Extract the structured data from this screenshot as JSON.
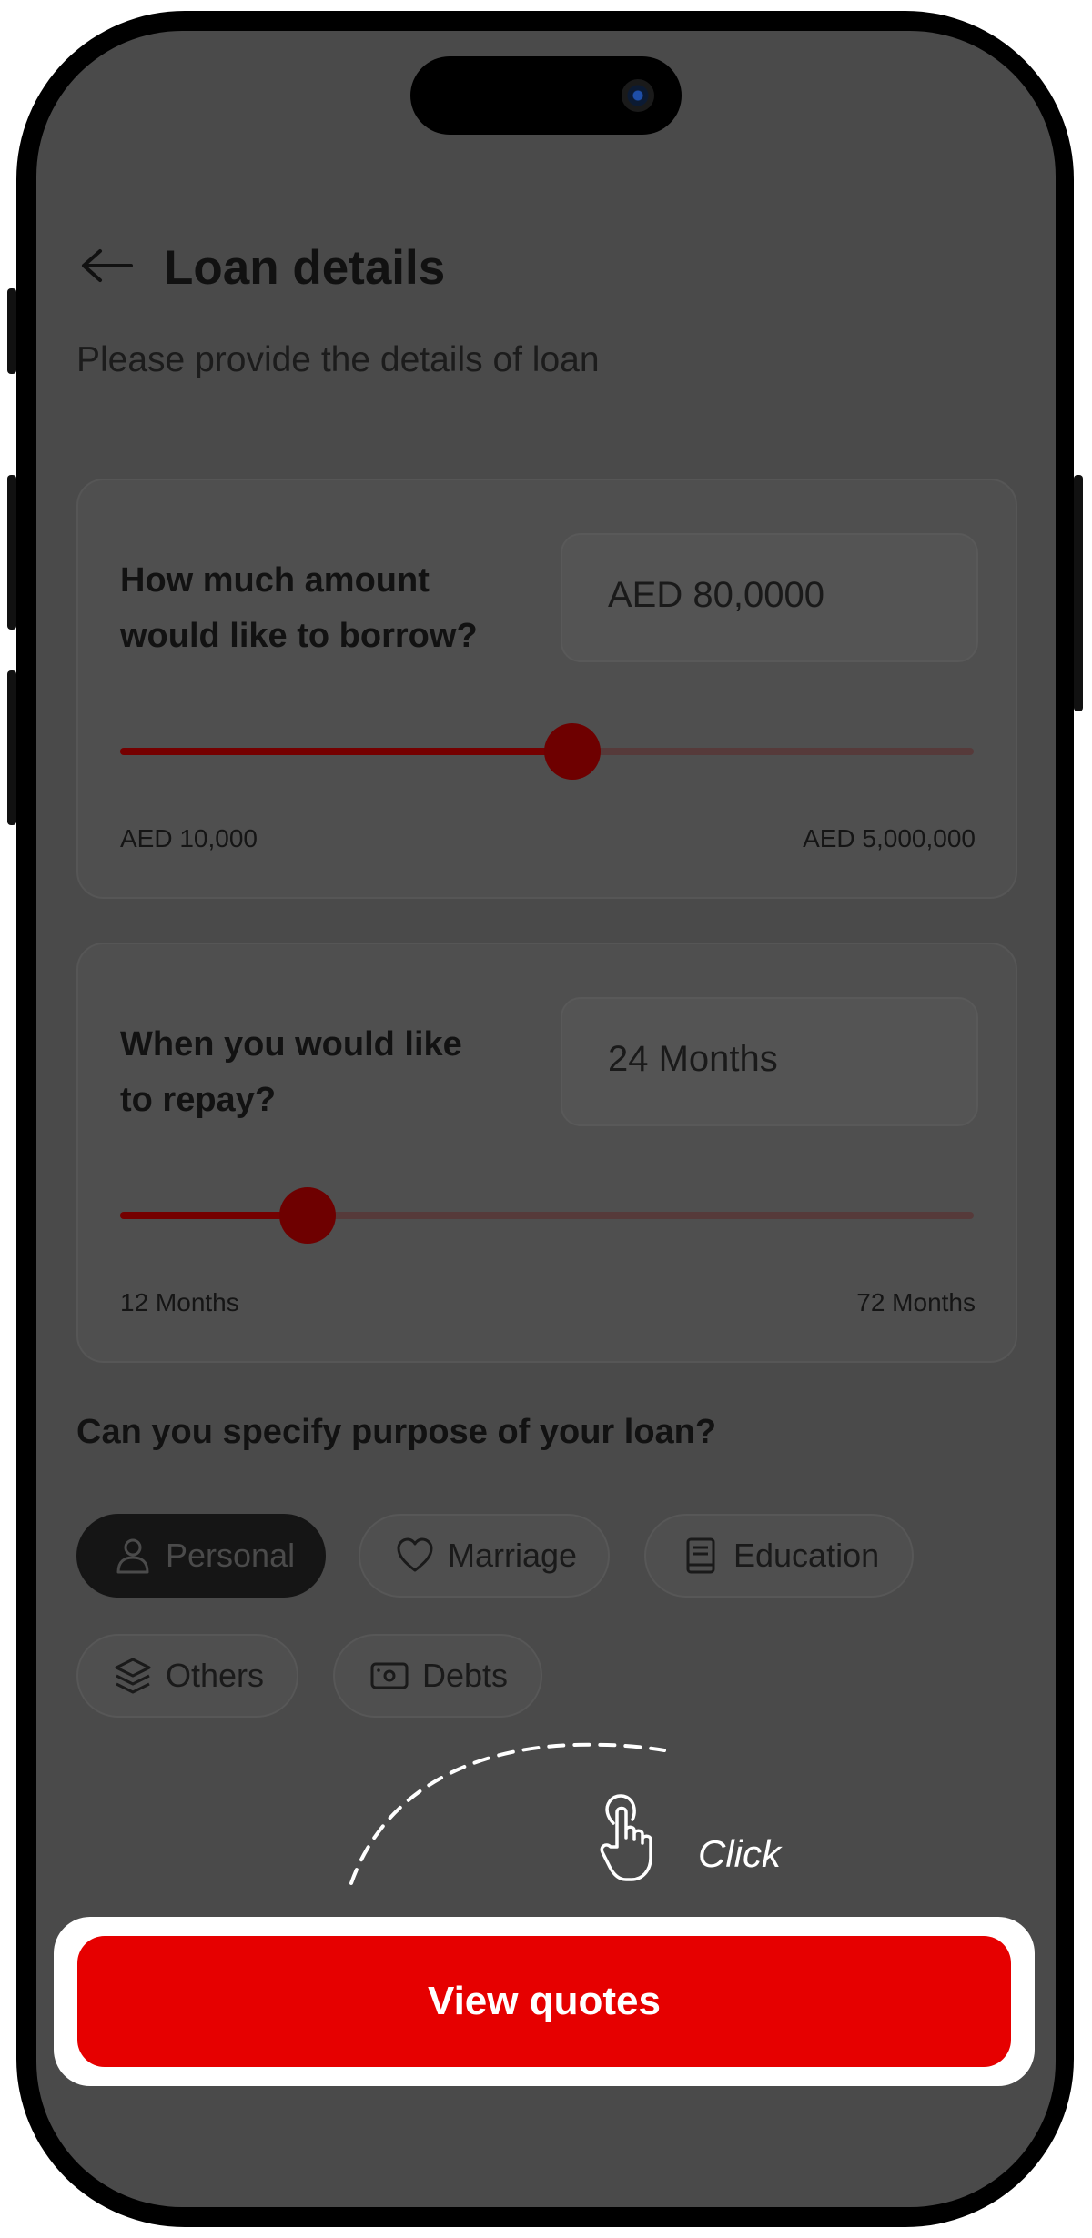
{
  "header": {
    "title": "Loan details",
    "subtitle": "Please provide the details of loan"
  },
  "amount": {
    "question_line1": "How much amount",
    "question_line2": "would like to borrow?",
    "value": "AED 80,0000",
    "min_label": "AED 10,000",
    "max_label": "AED 5,000,000",
    "slider_fraction": 0.53
  },
  "repay": {
    "question_line1": "When you would like",
    "question_line2": "to repay?",
    "value": "24 Months",
    "min_label": "12 Months",
    "max_label": "72 Months",
    "slider_fraction": 0.22
  },
  "purpose": {
    "question": "Can you specify purpose of your loan?",
    "chips": [
      {
        "label": "Personal",
        "icon": "person-icon",
        "selected": true
      },
      {
        "label": "Marriage",
        "icon": "heart-icon",
        "selected": false
      },
      {
        "label": "Education",
        "icon": "book-icon",
        "selected": false
      },
      {
        "label": "Others",
        "icon": "layers-icon",
        "selected": false
      },
      {
        "label": "Debts",
        "icon": "cash-icon",
        "selected": false
      }
    ]
  },
  "hint": {
    "click_label": "Click"
  },
  "cta": {
    "label": "View quotes"
  },
  "colors": {
    "accent": "#e60000",
    "overlay": "#4a4a4a",
    "slider_fill": "#750000"
  }
}
